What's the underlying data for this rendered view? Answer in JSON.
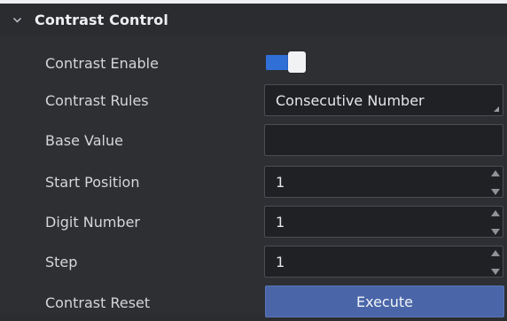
{
  "section": {
    "title": "Contrast Control"
  },
  "rows": {
    "contrast_enable": {
      "label": "Contrast Enable",
      "value": true
    },
    "contrast_rules": {
      "label": "Contrast Rules",
      "value": "Consecutive Number"
    },
    "base_value": {
      "label": "Base Value",
      "value": ""
    },
    "start_position": {
      "label": "Start Position",
      "value": "1"
    },
    "digit_number": {
      "label": "Digit Number",
      "value": "1"
    },
    "step": {
      "label": "Step",
      "value": "1"
    },
    "contrast_reset": {
      "label": "Contrast Reset",
      "button_label": "Execute"
    }
  },
  "colors": {
    "accent": "#2f6fd6",
    "button": "#4a66a8",
    "background": "#2d2f33"
  }
}
